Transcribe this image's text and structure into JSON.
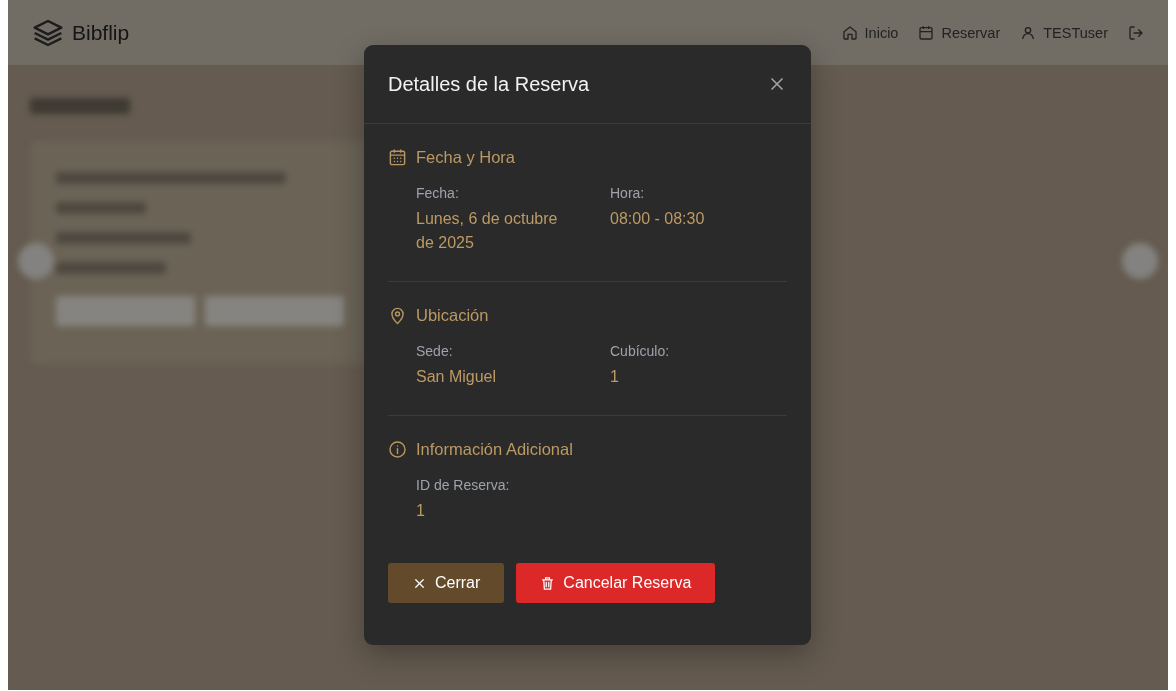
{
  "header": {
    "brand": "Bibflip",
    "nav": [
      {
        "kind": "home",
        "label": "Inicio"
      },
      {
        "kind": "calendar",
        "label": "Reservar"
      },
      {
        "kind": "user",
        "label": "TESTuser"
      },
      {
        "kind": "logout"
      }
    ]
  },
  "modal": {
    "title": "Detalles de la Reserva",
    "sections": [
      {
        "kind": "calendar",
        "title": "Fecha y Hora",
        "fields": [
          {
            "label": "Fecha:",
            "value": "Lunes, 6 de octubre de 2025"
          },
          {
            "label": "Hora:",
            "value": "08:00 - 08:30"
          }
        ]
      },
      {
        "kind": "location",
        "title": "Ubicación",
        "fields": [
          {
            "label": "Sede:",
            "value": "San Miguel"
          },
          {
            "label": "Cubículo:",
            "value": "1"
          }
        ]
      },
      {
        "kind": "info",
        "title": "Información Adicional",
        "fields": [
          {
            "label": "ID de Reserva:",
            "value": "1"
          }
        ]
      }
    ],
    "buttons": [
      {
        "kind": "close",
        "label": "Cerrar"
      },
      {
        "kind": "danger",
        "label": "Cancelar Reserva"
      }
    ]
  }
}
